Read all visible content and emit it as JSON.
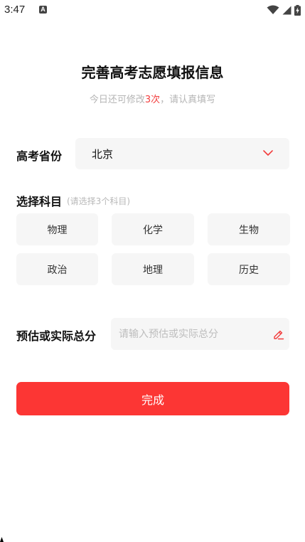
{
  "status_bar": {
    "time": "3:47",
    "notification_icon_label": "A",
    "icons": [
      "wifi-icon",
      "cellular-signal-icon",
      "battery-charging-icon"
    ]
  },
  "header": {
    "title": "完善高考志愿填报信息",
    "subtitle_prefix": "今日还可修改",
    "subtitle_count": "3次",
    "subtitle_suffix": "，请认真填写"
  },
  "province": {
    "label": "高考省份",
    "value": "北京",
    "icon": "chevron-down-icon"
  },
  "subjects": {
    "label": "选择科目",
    "hint": "(请选择3个科目)",
    "options": [
      {
        "label": "物理"
      },
      {
        "label": "化学"
      },
      {
        "label": "生物"
      },
      {
        "label": "政治"
      },
      {
        "label": "地理"
      },
      {
        "label": "历史"
      }
    ]
  },
  "score": {
    "label": "预估或实际总分",
    "value": "",
    "placeholder": "请输入预估或实际总分",
    "icon": "edit-pencil-icon"
  },
  "submit": {
    "label": "完成"
  },
  "colors": {
    "accent": "#fc3634",
    "highlight_text": "#f23d3d",
    "field_background": "#f6f6f6",
    "muted_text": "#b5b5b5"
  }
}
